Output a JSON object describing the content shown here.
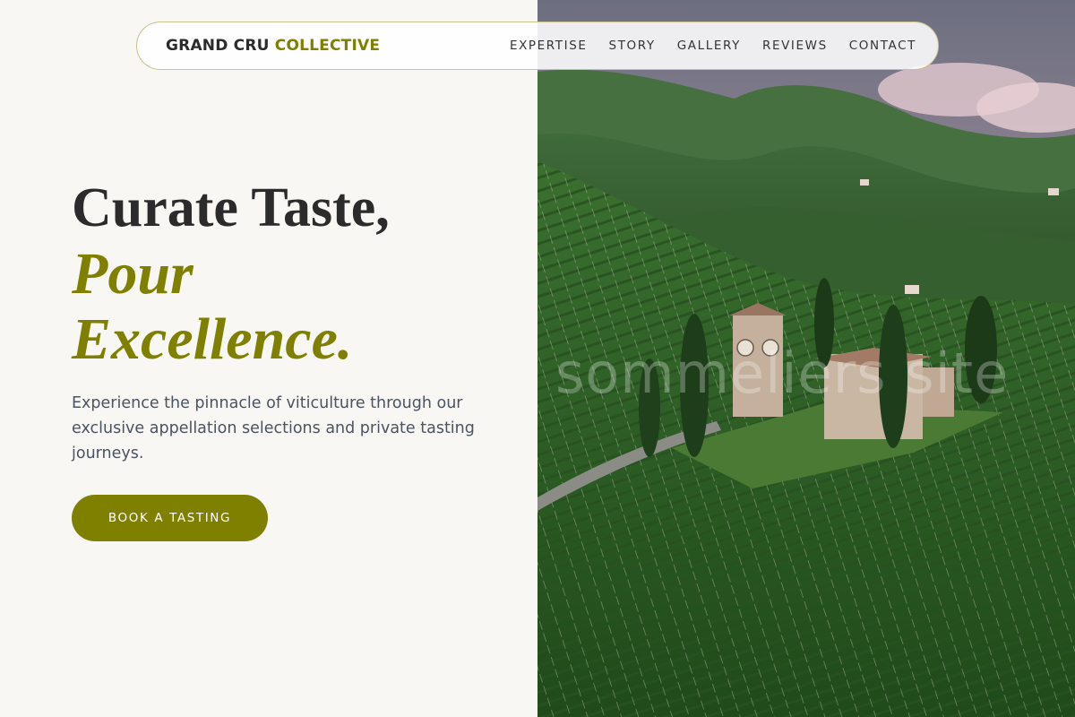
{
  "brand": {
    "name_part1": "GRAND CRU",
    "name_part2": "COLLECTIVE"
  },
  "nav": {
    "items": [
      "EXPERTISE",
      "STORY",
      "GALLERY",
      "REVIEWS",
      "CONTACT"
    ]
  },
  "hero": {
    "title_line1": "Curate Taste,",
    "title_line2": "Pour",
    "title_line3": "Excellence.",
    "description": "Experience the pinnacle of viticulture through our exclusive appellation selections and private tasting journeys.",
    "cta_label": "BOOK A TASTING"
  },
  "watermark": "sommeliers site",
  "colors": {
    "accent": "#7f7f00",
    "background": "#f9f7f4",
    "text_dark": "#2b2b2b"
  }
}
